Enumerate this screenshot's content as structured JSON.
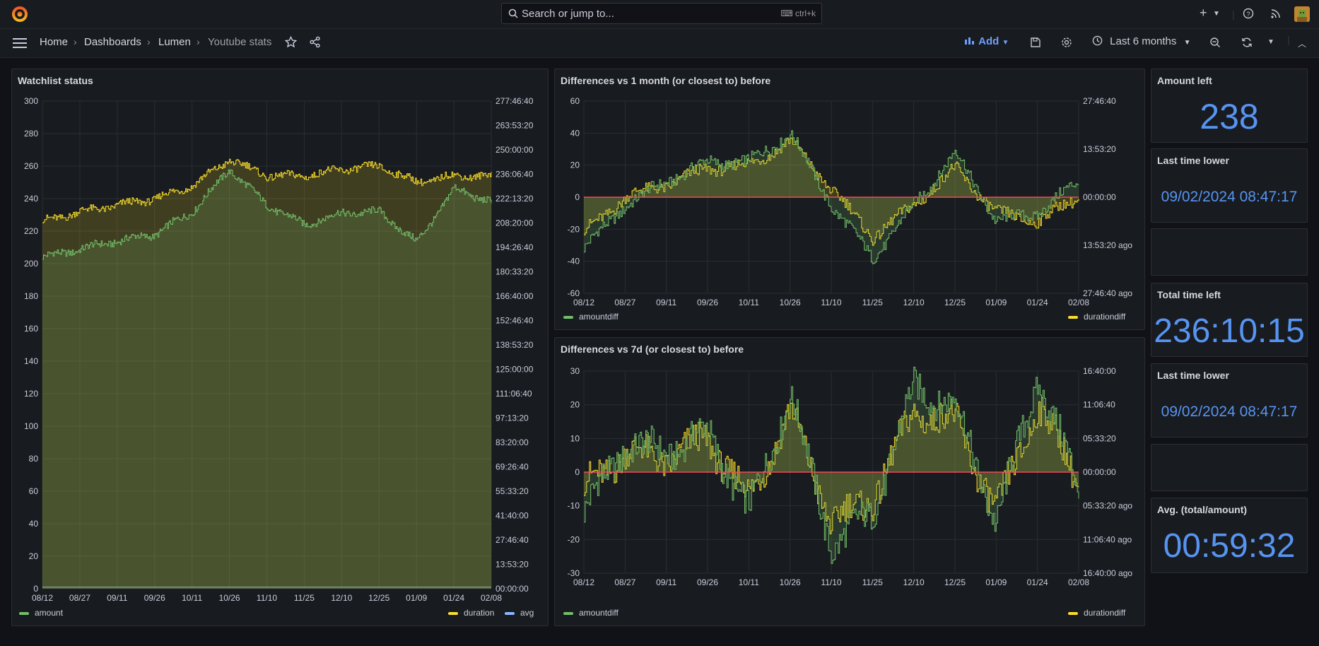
{
  "topbar": {
    "search_placeholder": "Search or jump to...",
    "shortcut": "ctrl+k"
  },
  "breadcrumb": {
    "home": "Home",
    "dashboards": "Dashboards",
    "folder": "Lumen",
    "page": "Youtube stats"
  },
  "toolbar": {
    "add_label": "Add",
    "time_range": "Last 6 months"
  },
  "x_ticks": [
    "08/12",
    "08/27",
    "09/11",
    "09/26",
    "10/11",
    "10/26",
    "11/10",
    "11/25",
    "12/10",
    "12/25",
    "01/09",
    "01/24",
    "02/08"
  ],
  "colors": {
    "green": "#73bf69",
    "yellow": "#fade2a",
    "blue": "#8ab8ff",
    "red": "#f2495c",
    "stat_blue": "#5794f2"
  },
  "panels": {
    "watchlist": {
      "title": "Watchlist status",
      "left_ticks": [
        "300",
        "280",
        "260",
        "240",
        "220",
        "200",
        "180",
        "160",
        "140",
        "120",
        "100",
        "80",
        "60",
        "40",
        "20",
        "0"
      ],
      "right_ticks": [
        "277:46:40",
        "263:53:20",
        "250:00:00",
        "236:06:40",
        "222:13:20",
        "208:20:00",
        "194:26:40",
        "180:33:20",
        "166:40:00",
        "152:46:40",
        "138:53:20",
        "125:00:00",
        "111:06:40",
        "97:13:20",
        "83:20:00",
        "69:26:40",
        "55:33:20",
        "41:40:00",
        "27:46:40",
        "13:53:20",
        "00:00:00"
      ],
      "legend": [
        "amount",
        "duration",
        "avg"
      ]
    },
    "diff_month": {
      "title": "Differences vs 1 month (or closest to) before",
      "left_ticks": [
        "60",
        "40",
        "20",
        "0",
        "-20",
        "-40",
        "-60"
      ],
      "right_ticks": [
        "27:46:40",
        "13:53:20",
        "00:00:00",
        "13:53:20 ago",
        "27:46:40 ago"
      ],
      "legend": [
        "amountdiff",
        "durationdiff"
      ]
    },
    "diff_week": {
      "title": "Differences vs 7d (or closest to) before",
      "left_ticks": [
        "30",
        "20",
        "10",
        "0",
        "-10",
        "-20",
        "-30"
      ],
      "right_ticks": [
        "16:40:00",
        "11:06:40",
        "05:33:20",
        "00:00:00",
        "05:33:20 ago",
        "11:06:40 ago",
        "16:40:00 ago"
      ],
      "legend": [
        "amountdiff",
        "durationdiff"
      ]
    }
  },
  "stats": [
    {
      "title": "Amount left",
      "value": "238"
    },
    {
      "title": "Last time lower",
      "value": "09/02/2024 08:47:17"
    },
    {
      "title": "",
      "value": ""
    },
    {
      "title": "Total time left",
      "value": "236:10:15"
    },
    {
      "title": "Last time lower",
      "value": "09/02/2024 08:47:17"
    },
    {
      "title": "",
      "value": ""
    },
    {
      "title": "Avg. (total/amount)",
      "value": "00:59:32"
    }
  ],
  "chart_data": [
    {
      "type": "line",
      "title": "Watchlist status",
      "x": [
        "08/12",
        "08/27",
        "09/11",
        "09/26",
        "10/11",
        "10/26",
        "11/10",
        "11/25",
        "12/10",
        "12/25",
        "01/09",
        "01/24",
        "02/08"
      ],
      "series": [
        {
          "name": "amount",
          "values": [
            204,
            209,
            214,
            218,
            232,
            258,
            236,
            224,
            231,
            232,
            213,
            246,
            238
          ]
        },
        {
          "name": "duration",
          "values": [
            226,
            232,
            236,
            240,
            248,
            264,
            254,
            254,
            258,
            260,
            250,
            254,
            254
          ]
        },
        {
          "name": "avg",
          "values": [
            1,
            1,
            1,
            1,
            1,
            1,
            1,
            1,
            1,
            1,
            1,
            1,
            1
          ]
        }
      ],
      "ylim": [
        0,
        300
      ]
    },
    {
      "type": "line",
      "title": "Differences vs 1 month (or closest to) before",
      "x": [
        "08/12",
        "08/27",
        "09/11",
        "09/26",
        "10/11",
        "10/26",
        "11/10",
        "11/25",
        "12/10",
        "12/25",
        "01/09",
        "01/24",
        "02/08"
      ],
      "series": [
        {
          "name": "amountdiff",
          "values": [
            -32,
            -5,
            10,
            22,
            22,
            40,
            -5,
            -38,
            -5,
            28,
            -15,
            -10,
            10
          ]
        },
        {
          "name": "durationdiff",
          "values": [
            -22,
            0,
            8,
            18,
            20,
            35,
            5,
            -25,
            -5,
            18,
            -10,
            -15,
            0
          ]
        }
      ],
      "ylim": [
        -60,
        60
      ]
    },
    {
      "type": "line",
      "title": "Differences vs 7d (or closest to) before",
      "x": [
        "08/12",
        "08/27",
        "09/11",
        "09/26",
        "10/11",
        "10/26",
        "11/10",
        "11/25",
        "12/10",
        "12/25",
        "01/09",
        "01/24",
        "02/08"
      ],
      "series": [
        {
          "name": "amountdiff",
          "values": [
            -12,
            8,
            6,
            12,
            -12,
            23,
            -22,
            -12,
            25,
            20,
            -15,
            28,
            -5
          ]
        },
        {
          "name": "durationdiff",
          "values": [
            -5,
            6,
            4,
            10,
            -8,
            18,
            -15,
            -8,
            18,
            15,
            -12,
            20,
            -3
          ]
        }
      ],
      "ylim": [
        -30,
        30
      ]
    }
  ]
}
